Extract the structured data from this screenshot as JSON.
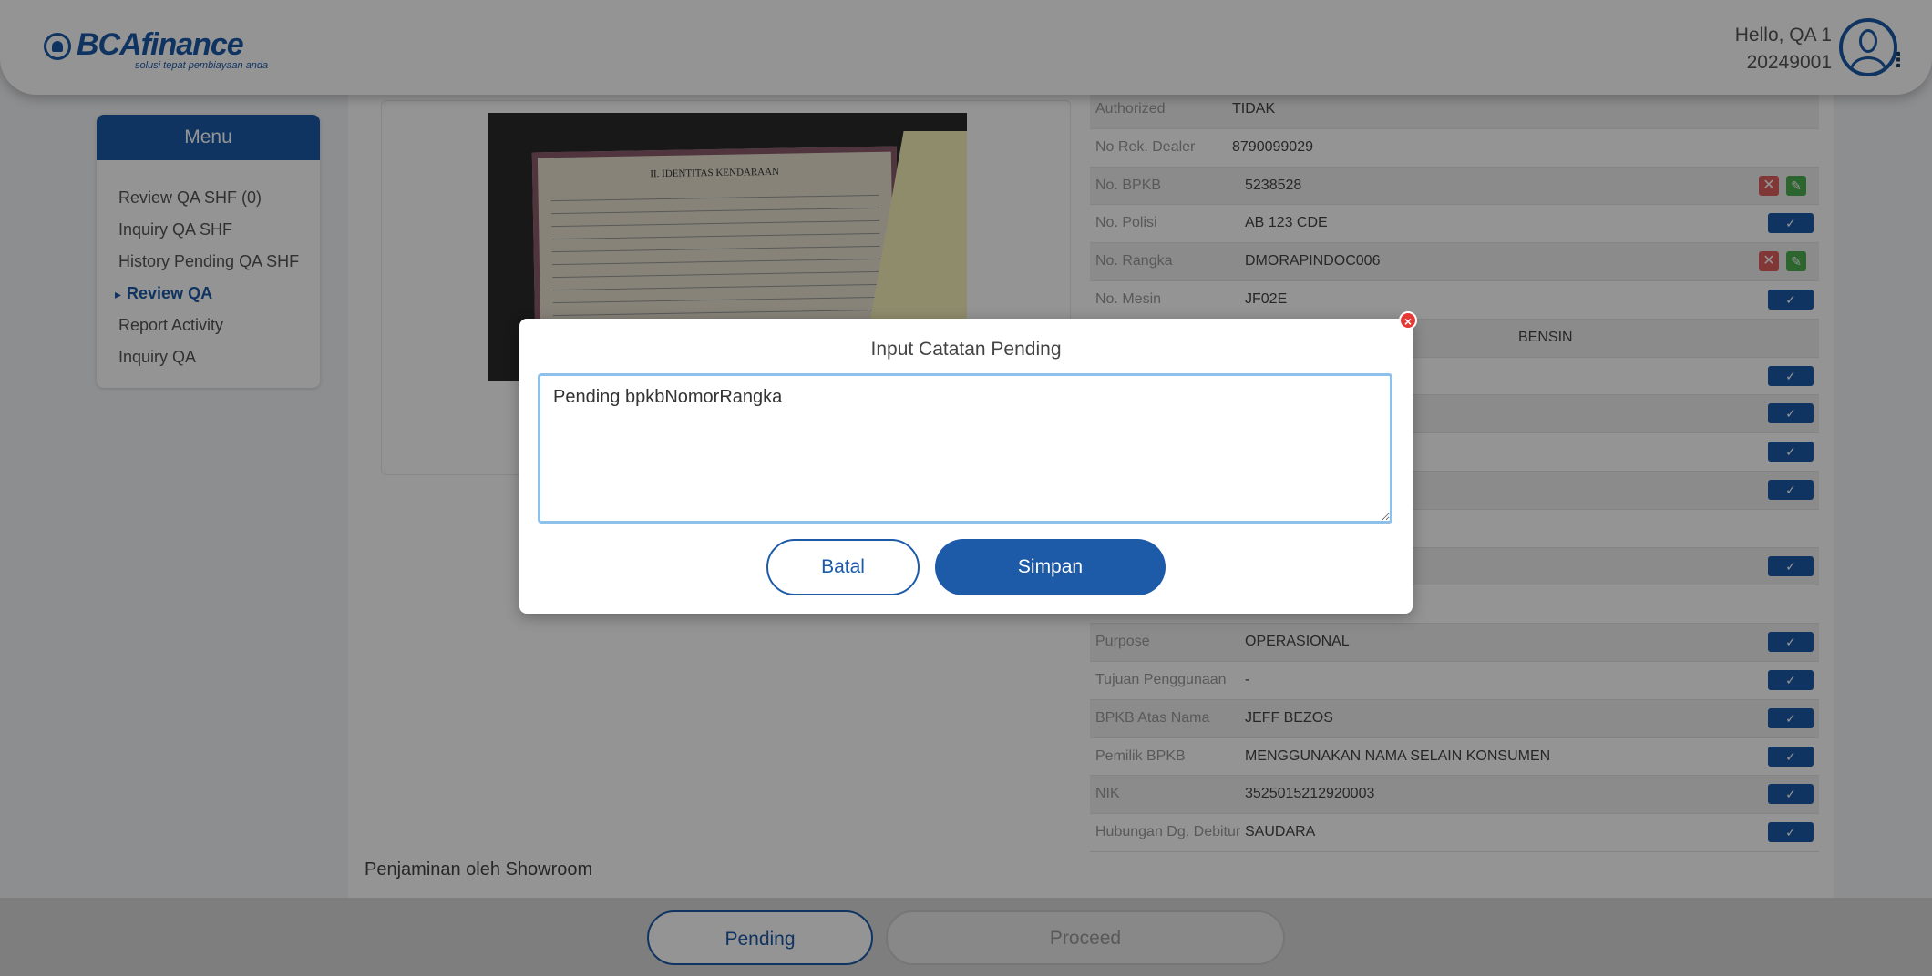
{
  "header": {
    "logo_text": "BCA",
    "logo_text_fin": "finance",
    "logo_tagline": "solusi tepat pembiayaan anda",
    "greeting": "Hello, QA 1",
    "user_id": "20249001"
  },
  "sidebar": {
    "title": "Menu",
    "items": [
      {
        "label": "Review QA SHF (0)"
      },
      {
        "label": "Inquiry QA SHF"
      },
      {
        "label": "History Pending QA SHF"
      },
      {
        "label": "Review QA"
      },
      {
        "label": "Report Activity"
      },
      {
        "label": "Inquiry QA"
      }
    ]
  },
  "details": {
    "rows": [
      {
        "label": "Authorized",
        "value": "TIDAK"
      },
      {
        "label": "No Rek. Dealer",
        "value": "8790099029"
      },
      {
        "label": "No. BPKB",
        "value": "5238528"
      },
      {
        "label": "No. Polisi",
        "value": "AB 123 CDE"
      },
      {
        "label": "No. Rangka",
        "value": "DMORAPINDOC006"
      },
      {
        "label": "No. Mesin",
        "value": "JF02E"
      },
      {
        "label": "",
        "value": "BENSIN"
      },
      {
        "label": "Purpose",
        "value": "OPERASIONAL"
      },
      {
        "label": "Tujuan Penggunaan",
        "value": "-"
      },
      {
        "label": "BPKB Atas Nama",
        "value": "JEFF BEZOS"
      },
      {
        "label": "Pemilik BPKB",
        "value": "MENGGUNAKAN NAMA SELAIN KONSUMEN"
      },
      {
        "label": "NIK",
        "value": "3525015212920003"
      },
      {
        "label": "Hubungan Dg. Debitur",
        "value": "SAUDARA"
      }
    ]
  },
  "document": {
    "title": "II. IDENTITAS KENDARAAN"
  },
  "section": {
    "title": "Penjaminan oleh Showroom"
  },
  "footer": {
    "pending_label": "Pending",
    "proceed_label": "Proceed"
  },
  "modal": {
    "title": "Input Catatan Pending",
    "textarea_value": "Pending bpkbNomorRangka",
    "cancel_label": "Batal",
    "save_label": "Simpan"
  },
  "colors": {
    "brand": "#1d5aa8",
    "reject": "#e06060",
    "edit": "#4caf50",
    "close": "#e53935"
  }
}
